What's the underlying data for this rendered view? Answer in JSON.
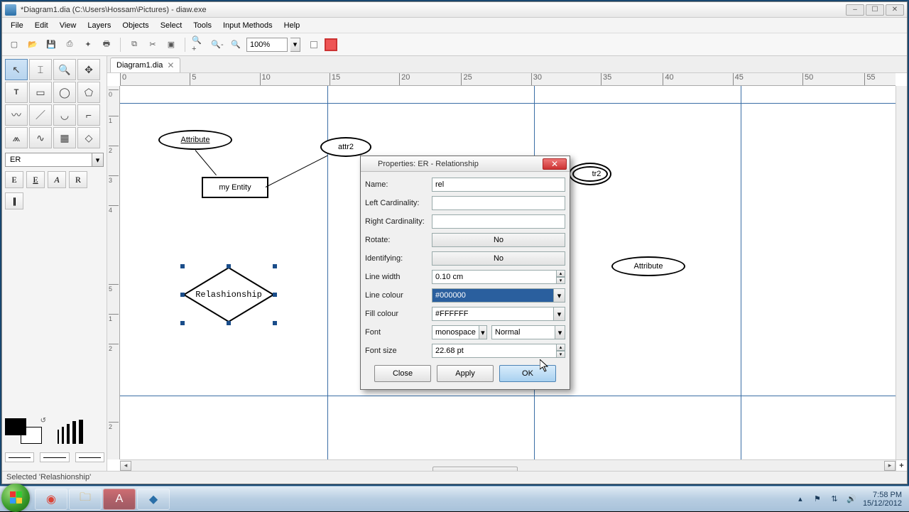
{
  "window": {
    "title": "*Diagram1.dia (C:\\Users\\Hossam\\Pictures) - diaw.exe"
  },
  "menu": [
    "File",
    "Edit",
    "View",
    "Layers",
    "Objects",
    "Select",
    "Tools",
    "Input Methods",
    "Help"
  ],
  "toolbar": {
    "zoom": "100%"
  },
  "toolbox": {
    "sheet": "ER",
    "er_labels": [
      "E",
      "E",
      "A",
      "R"
    ]
  },
  "tab": {
    "name": "Diagram1.dia"
  },
  "ruler_h": [
    "0",
    "5",
    "10",
    "15",
    "20",
    "25",
    "30",
    "35",
    "40",
    "45",
    "50",
    "55"
  ],
  "ruler_v": [
    "0",
    "1",
    "2",
    "3",
    "4",
    "5",
    "1",
    "2",
    "2"
  ],
  "shapes": {
    "attr1": "Attribute",
    "attr2": "attr2",
    "attr3_partial": "tr2",
    "attr4": "Attribute",
    "entity": "my Entity",
    "relationship": "Relashionship"
  },
  "dialog": {
    "title": "Properties: ER - Relationship",
    "labels": {
      "name": "Name:",
      "left": "Left Cardinality:",
      "right": "Right Cardinality:",
      "rotate": "Rotate:",
      "identifying": "Identifying:",
      "linewidth": "Line width",
      "linecolour": "Line colour",
      "fillcolour": "Fill colour",
      "font": "Font",
      "fontsize": "Font size"
    },
    "values": {
      "name": "rel",
      "left": "",
      "right": "",
      "rotate": "No",
      "identifying": "No",
      "linewidth": "0.10 cm",
      "linecolour": "#000000",
      "fillcolour": "#FFFFFF",
      "fontname": "monospace",
      "fontstyle": "Normal",
      "fontsize": "22.68 pt"
    },
    "buttons": {
      "close": "Close",
      "apply": "Apply",
      "ok": "OK"
    }
  },
  "status": "Selected 'Relashionship'",
  "tray": {
    "time": "7:58 PM",
    "date": "15/12/2012"
  }
}
